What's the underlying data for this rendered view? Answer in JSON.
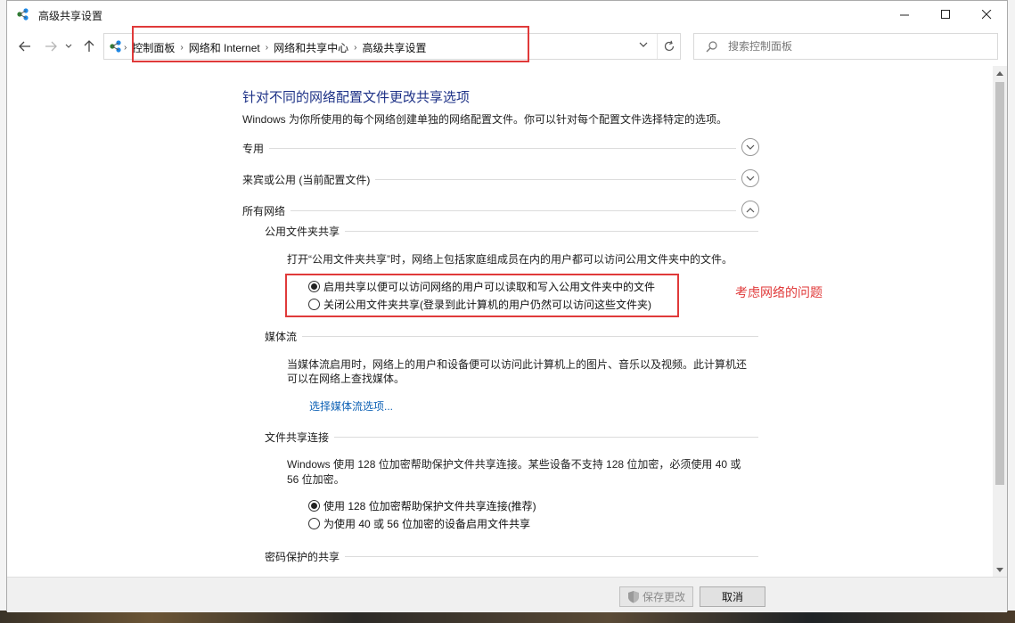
{
  "window": {
    "title": "高级共享设置"
  },
  "address": {
    "breadcrumbs": [
      "控制面板",
      "网络和 Internet",
      "网络和共享中心",
      "高级共享设置"
    ]
  },
  "search": {
    "placeholder": "搜索控制面板"
  },
  "main": {
    "heading": "针对不同的网络配置文件更改共享选项",
    "description": "Windows 为你所使用的每个网络创建单独的网络配置文件。你可以针对每个配置文件选择特定的选项。",
    "profiles": [
      {
        "label": "专用",
        "expanded": false
      },
      {
        "label": "来宾或公用 (当前配置文件)",
        "expanded": false
      },
      {
        "label": "所有网络",
        "expanded": true
      }
    ],
    "public_folder": {
      "title": "公用文件夹共享",
      "desc": "打开“公用文件夹共享”时，网络上包括家庭组成员在内的用户都可以访问公用文件夹中的文件。",
      "options": [
        {
          "label": "启用共享以便可以访问网络的用户可以读取和写入公用文件夹中的文件",
          "checked": true
        },
        {
          "label": "关闭公用文件夹共享(登录到此计算机的用户仍然可以访问这些文件夹)",
          "checked": false
        }
      ]
    },
    "media": {
      "title": "媒体流",
      "desc_line1": "当媒体流启用时，网络上的用户和设备便可以访问此计算机上的图片、音乐以及视频。此计算机还",
      "desc_line2": "可以在网络上查找媒体。",
      "link": "选择媒体流选项..."
    },
    "file_sharing": {
      "title": "文件共享连接",
      "desc_line1": "Windows 使用 128 位加密帮助保护文件共享连接。某些设备不支持 128 位加密，必须使用 40 或",
      "desc_line2": "56 位加密。",
      "options": [
        {
          "label": "使用 128 位加密帮助保护文件共享连接(推荐)",
          "checked": true
        },
        {
          "label": "为使用 40 或 56 位加密的设备启用文件共享",
          "checked": false
        }
      ]
    },
    "password": {
      "title": "密码保护的共享"
    }
  },
  "annotation": "考虑网络的问题",
  "footer": {
    "save_label": "保存更改",
    "cancel_label": "取消"
  },
  "colors": {
    "accent_red": "#e03a3a",
    "heading_blue": "#1e3287",
    "link_blue": "#0f62b5"
  },
  "icons": [
    "network-icon",
    "back-arrow-icon",
    "forward-arrow-icon",
    "dropdown-icon",
    "up-arrow-icon",
    "refresh-icon",
    "search-icon",
    "chevron-down-icon",
    "chevron-up-icon",
    "shield-icon"
  ]
}
